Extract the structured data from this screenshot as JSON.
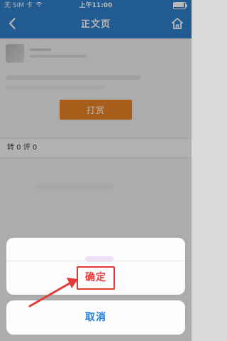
{
  "statusbar": {
    "carrier": "无 SIM 卡",
    "wifi_icon": "wifi-icon",
    "time": "上午11:00",
    "battery_icon": "battery-icon"
  },
  "navbar": {
    "title": "正文页",
    "back_icon": "back-chevron-icon",
    "home_icon": "home-icon"
  },
  "page": {
    "reward_button_label": "打赏",
    "stats_text": "转 0 评 0"
  },
  "action_sheet": {
    "confirm_label": "确定",
    "cancel_label": "取消"
  },
  "colors": {
    "nav_blue": "#2f7fca",
    "reward_orange": "#e98324",
    "confirm_red": "#e53935",
    "cancel_blue": "#1f7ae0"
  }
}
